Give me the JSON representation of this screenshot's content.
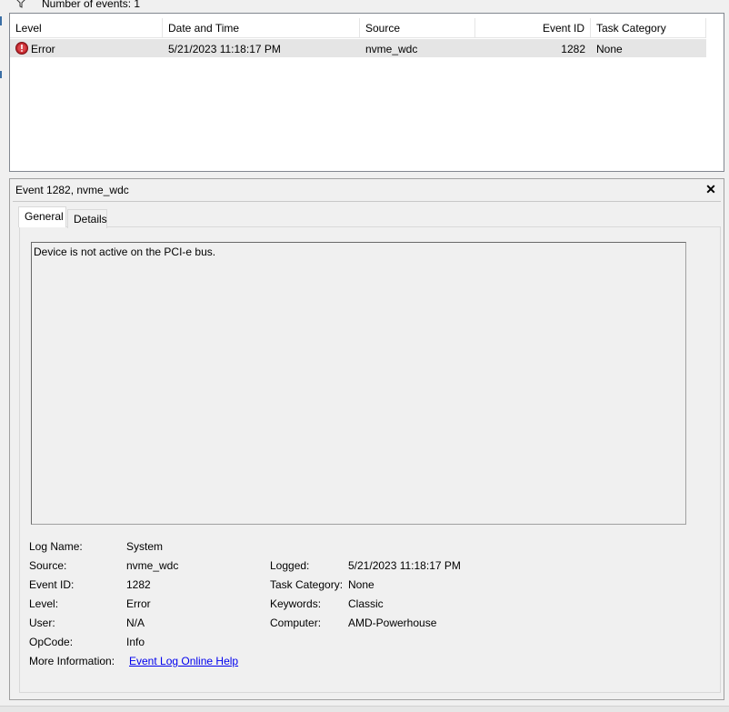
{
  "filter_bar": {
    "event_count_text": "Number of events: 1",
    "filter_icon": "filter-funnel-icon"
  },
  "events_table": {
    "columns": [
      "Level",
      "Date and Time",
      "Source",
      "Event ID",
      "Task Category"
    ],
    "rows": [
      {
        "level_icon": "error-icon",
        "level": "Error",
        "date_time": "5/21/2023 11:18:17 PM",
        "source": "nvme_wdc",
        "event_id": "1282",
        "task_category": "None"
      }
    ]
  },
  "detail": {
    "title": "Event 1282, nvme_wdc",
    "close_label": "✕",
    "tabs": [
      {
        "label": "General",
        "selected": true
      },
      {
        "label": "Details",
        "selected": false
      }
    ],
    "description": "Device is not active on the PCI-e bus.",
    "fields": {
      "log_name_label": "Log Name:",
      "log_name": "System",
      "source_label": "Source:",
      "source": "nvme_wdc",
      "logged_label": "Logged:",
      "logged": "5/21/2023 11:18:17 PM",
      "event_id_label": "Event ID:",
      "event_id": "1282",
      "task_category_label": "Task Category:",
      "task_category": "None",
      "level_label": "Level:",
      "level": "Error",
      "keywords_label": "Keywords:",
      "keywords": "Classic",
      "user_label": "User:",
      "user": "N/A",
      "computer_label": "Computer:",
      "computer": "AMD-Powerhouse",
      "opcode_label": "OpCode:",
      "opcode": "Info",
      "more_info_label": "More Information:",
      "more_info_link": "Event Log Online Help"
    }
  },
  "colors": {
    "window_bg": "#f0f0f0",
    "selected_row": "#e5e5e5",
    "link": "#0000ee",
    "error_icon": "#c1272d"
  }
}
